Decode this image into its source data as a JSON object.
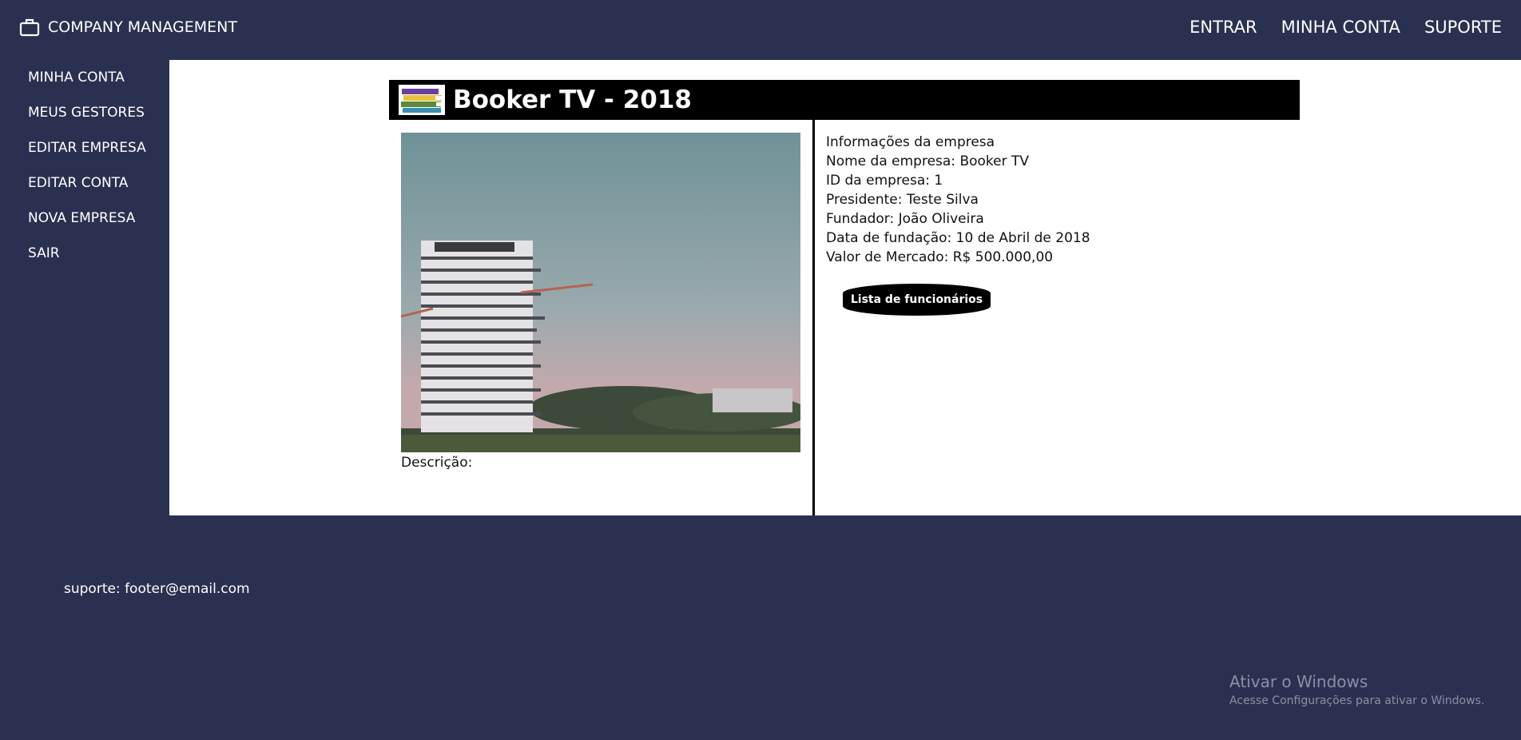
{
  "header": {
    "brand": "COMPANY MANAGEMENT",
    "nav": [
      "ENTRAR",
      "MINHA CONTA",
      "SUPORTE"
    ]
  },
  "sidebar": {
    "items": [
      "MINHA CONTA",
      "MEUS GESTORES",
      "EDITAR EMPRESA",
      "EDITAR CONTA",
      "NOVA EMPRESA",
      "SAIR"
    ]
  },
  "company": {
    "title": "Booker TV - 2018",
    "description_label": "Descrição:",
    "info": [
      "Informações da empresa",
      "Nome da empresa: Booker TV",
      "ID da empresa: 1",
      "Presidente: Teste Silva",
      "Fundador: João Oliveira",
      "Data de fundação: 10 de Abril de 2018",
      "Valor de Mercado: R$ 500.000,00"
    ],
    "employees_button": "Lista de funcionários"
  },
  "footer": {
    "support": "suporte: footer@email.com"
  },
  "watermark": {
    "line1": "Ativar o Windows",
    "line2": "Acesse Configurações para ativar o Windows."
  }
}
